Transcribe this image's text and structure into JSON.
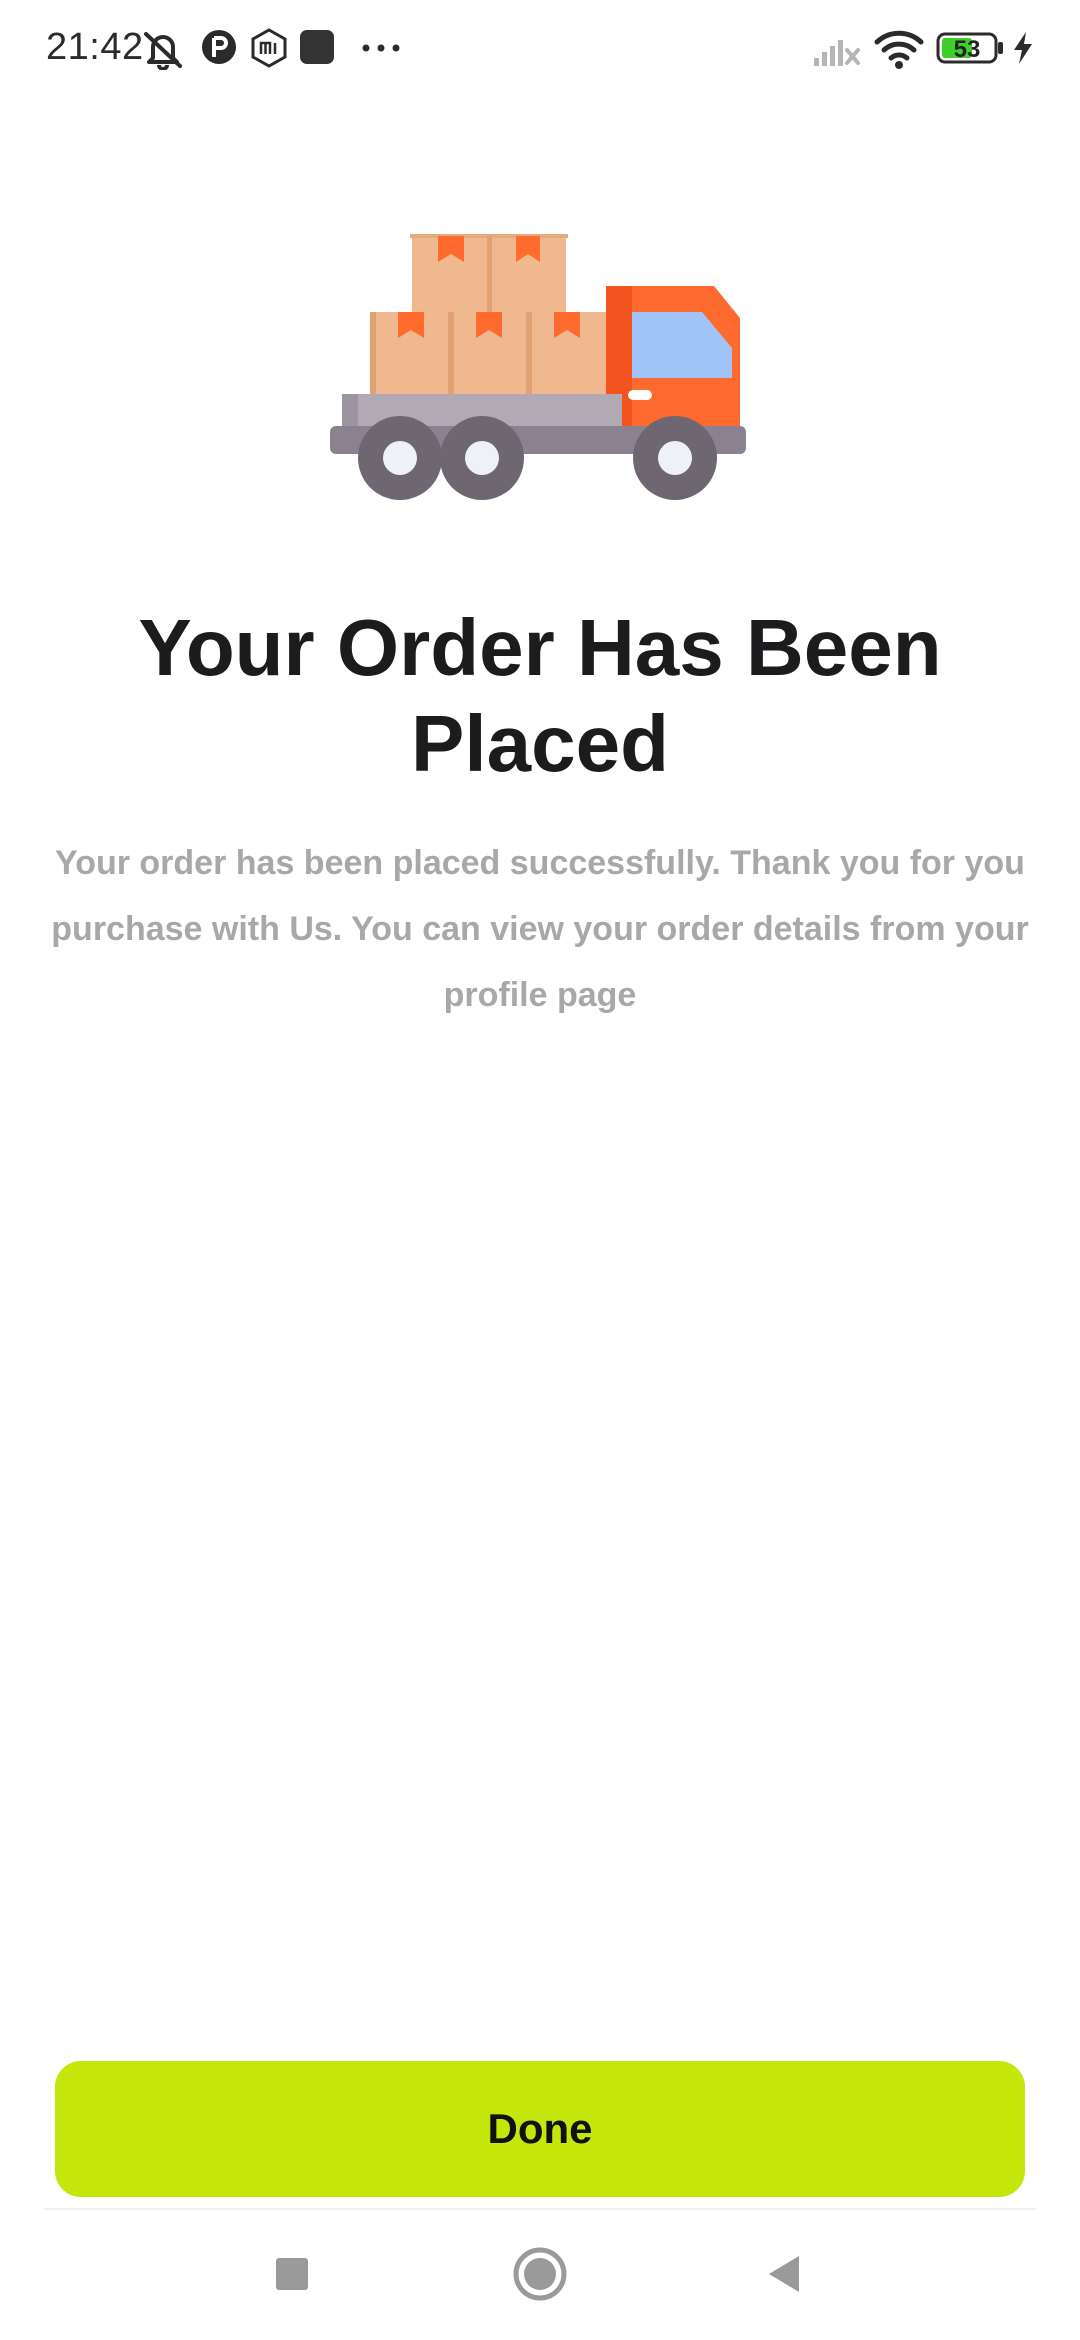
{
  "status_bar": {
    "time": "21:42",
    "battery_level": "53",
    "left_icons": [
      "bell-off-icon",
      "app-p-icon",
      "mi-icon",
      "square-app-icon",
      "more-dots-icon"
    ],
    "right_icons": [
      "signal-off-icon",
      "wifi-icon",
      "battery-icon",
      "charging-bolt-icon"
    ]
  },
  "hero": {
    "illustration": "delivery-truck-icon"
  },
  "content": {
    "title": "Your Order Has Been Placed",
    "message": "Your order has been placed successfully. Thank you for you purchase with Us. You can view your order details from your profile page"
  },
  "actions": {
    "done_label": "Done"
  },
  "nav_bar": {
    "items": [
      "recents-square-icon",
      "home-circle-icon",
      "back-triangle-icon"
    ]
  },
  "colors": {
    "accent": "#c4e60a",
    "title": "#1c1c1e",
    "message": "#a8a8ab",
    "truck_cab": "#ff6a2f",
    "truck_window": "#a0c4f8",
    "box": "#efb88f"
  }
}
